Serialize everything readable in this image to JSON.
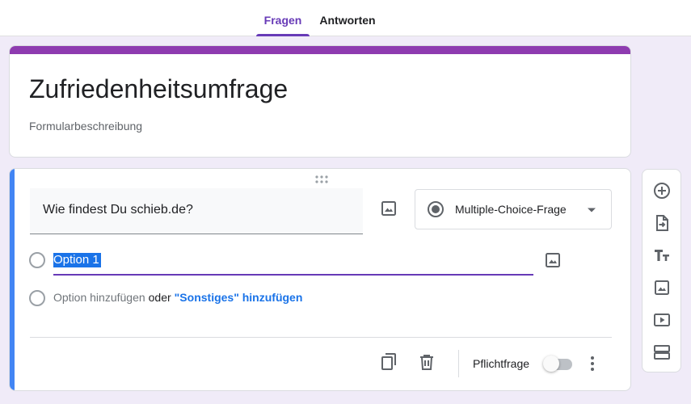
{
  "tabs": {
    "questions": "Fragen",
    "responses": "Antworten"
  },
  "form": {
    "title": "Zufriedenheitsumfrage",
    "description": "Formularbeschreibung"
  },
  "question": {
    "text": "Wie findest Du schieb.de?",
    "type": "Multiple-Choice-Frage",
    "options": [
      "Option 1"
    ],
    "add_option": "Option hinzufügen",
    "or_word": "oder",
    "add_other": "\"Sonstiges\" hinzufügen",
    "required_label": "Pflichtfrage",
    "required": false
  },
  "colors": {
    "accent": "#673ab7",
    "header_stripe": "#8e3bb0",
    "focus_bar": "#4285f4",
    "link": "#1a73e8",
    "background": "#f0ebf8"
  },
  "icons": {
    "question_image": "image-icon",
    "type_select": "radio-button-checked-icon",
    "copy": "content-copy-icon",
    "delete": "trash-icon",
    "more": "more-vert-icon",
    "sidebar": [
      "add-circle-icon",
      "import-questions-icon",
      "title-text-icon",
      "image-icon",
      "video-icon",
      "section-icon"
    ]
  }
}
